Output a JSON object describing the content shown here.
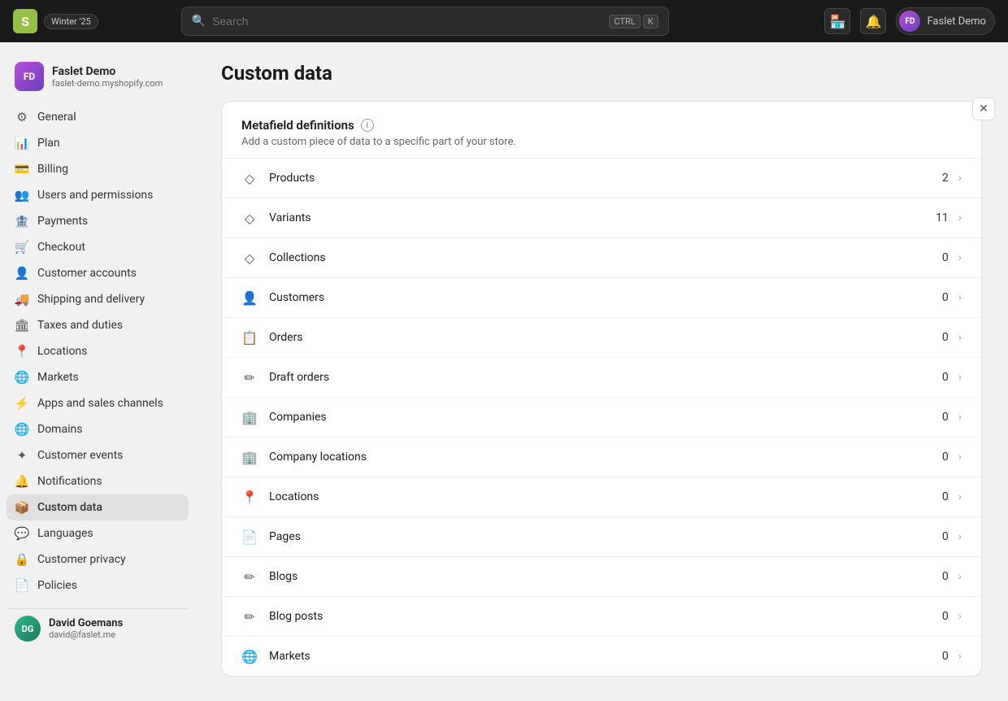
{
  "topnav": {
    "logo_text": "shopify",
    "badge": "Winter '25",
    "search_placeholder": "Search",
    "shortcut_ctrl": "CTRL",
    "shortcut_k": "K",
    "user_initials": "FD",
    "user_name": "Faslet Demo"
  },
  "sidebar": {
    "store_name": "Faslet Demo",
    "store_url": "faslet-demo.myshopify.com",
    "store_initials": "FD",
    "nav_items": [
      {
        "id": "general",
        "label": "General",
        "icon": "⚙"
      },
      {
        "id": "plan",
        "label": "Plan",
        "icon": "📊"
      },
      {
        "id": "billing",
        "label": "Billing",
        "icon": "💳"
      },
      {
        "id": "users-permissions",
        "label": "Users and permissions",
        "icon": "👥"
      },
      {
        "id": "payments",
        "label": "Payments",
        "icon": "🏦"
      },
      {
        "id": "checkout",
        "label": "Checkout",
        "icon": "🛒"
      },
      {
        "id": "customer-accounts",
        "label": "Customer accounts",
        "icon": "👤"
      },
      {
        "id": "shipping-delivery",
        "label": "Shipping and delivery",
        "icon": "🚚"
      },
      {
        "id": "taxes-duties",
        "label": "Taxes and duties",
        "icon": "🏛"
      },
      {
        "id": "locations",
        "label": "Locations",
        "icon": "📍"
      },
      {
        "id": "markets",
        "label": "Markets",
        "icon": "🌐"
      },
      {
        "id": "apps-sales-channels",
        "label": "Apps and sales channels",
        "icon": "⚡"
      },
      {
        "id": "domains",
        "label": "Domains",
        "icon": "🌐"
      },
      {
        "id": "customer-events",
        "label": "Customer events",
        "icon": "✦"
      },
      {
        "id": "notifications",
        "label": "Notifications",
        "icon": "🔔"
      },
      {
        "id": "custom-data",
        "label": "Custom data",
        "icon": "📦"
      },
      {
        "id": "languages",
        "label": "Languages",
        "icon": "💬"
      },
      {
        "id": "customer-privacy",
        "label": "Customer privacy",
        "icon": "🔒"
      },
      {
        "id": "policies",
        "label": "Policies",
        "icon": "📄"
      }
    ],
    "footer_name": "David Goemans",
    "footer_email": "david@faslet.me",
    "footer_initials": "DG"
  },
  "main": {
    "page_title": "Custom data",
    "card": {
      "header_title": "Metafield definitions",
      "header_subtitle": "Add a custom piece of data to a specific part of your store.",
      "rows": [
        {
          "id": "products",
          "label": "Products",
          "count": "2",
          "icon": "◇"
        },
        {
          "id": "variants",
          "label": "Variants",
          "count": "11",
          "icon": "◇"
        },
        {
          "id": "collections",
          "label": "Collections",
          "count": "0",
          "icon": "◇"
        },
        {
          "id": "customers",
          "label": "Customers",
          "count": "0",
          "icon": "👤"
        },
        {
          "id": "orders",
          "label": "Orders",
          "count": "0",
          "icon": "📋"
        },
        {
          "id": "draft-orders",
          "label": "Draft orders",
          "count": "0",
          "icon": "✏"
        },
        {
          "id": "companies",
          "label": "Companies",
          "count": "0",
          "icon": "🏢"
        },
        {
          "id": "company-locations",
          "label": "Company locations",
          "count": "0",
          "icon": "🏢"
        },
        {
          "id": "locations",
          "label": "Locations",
          "count": "0",
          "icon": "📍"
        },
        {
          "id": "pages",
          "label": "Pages",
          "count": "0",
          "icon": "📄"
        },
        {
          "id": "blogs",
          "label": "Blogs",
          "count": "0",
          "icon": "✏"
        },
        {
          "id": "blog-posts",
          "label": "Blog posts",
          "count": "0",
          "icon": "✏"
        },
        {
          "id": "markets",
          "label": "Markets",
          "count": "0",
          "icon": "🌐"
        }
      ]
    }
  }
}
